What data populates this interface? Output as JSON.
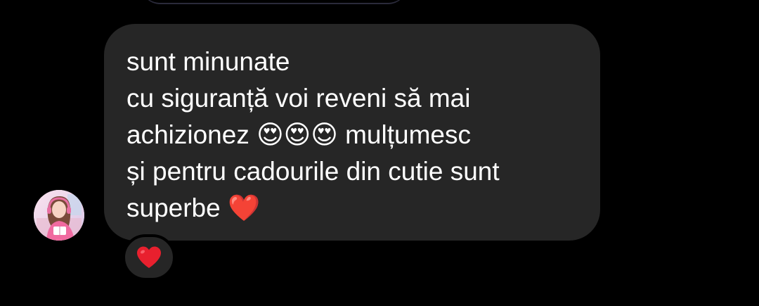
{
  "thread": {
    "message": {
      "lines": [
        "sunt minunate",
        "cu siguranță voi reveni să mai",
        "achizionez 😍😍😍 mulțumesc",
        "și pentru cadourile din cutie sunt",
        "superbe ❤️"
      ],
      "line3_prefix": "achizionez ",
      "line3_emojis": "😍😍😍",
      "line3_suffix": " mulțumesc",
      "line5_text": "superbe ",
      "line5_emoji": "❤️"
    },
    "sender": {
      "avatar_icon": "user-avatar-photo"
    },
    "reaction": {
      "emoji": "❤️",
      "icon": "heart-icon"
    }
  },
  "colors": {
    "background": "#000000",
    "bubble": "#262626",
    "text": "#ffffff",
    "heart": "#e8202e"
  }
}
